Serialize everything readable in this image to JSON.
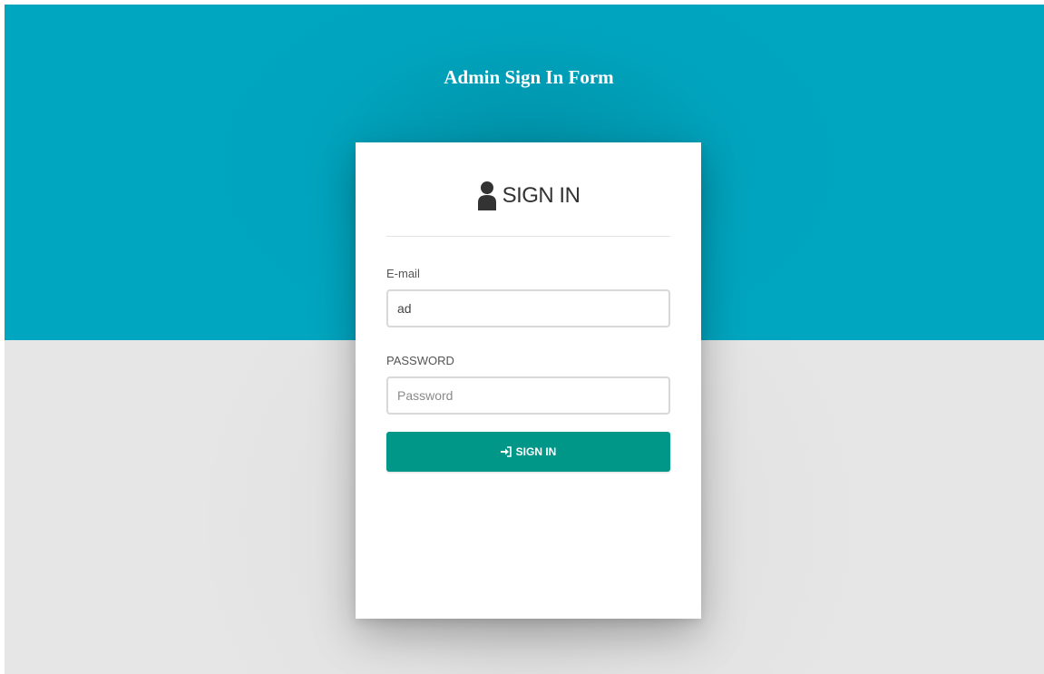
{
  "page": {
    "title": "Admin Sign In Form"
  },
  "card": {
    "title": "SIGN IN",
    "title_icon": "user-icon"
  },
  "form": {
    "email_label": "E-mail",
    "email_value": "ad",
    "password_label": "PASSWORD",
    "password_placeholder": "Password",
    "submit_label": "SIGN IN",
    "submit_icon": "sign-in-icon"
  },
  "colors": {
    "header_band": "#00a6c0",
    "background": "#e6e6e6",
    "button": "#009688",
    "card": "#ffffff"
  }
}
